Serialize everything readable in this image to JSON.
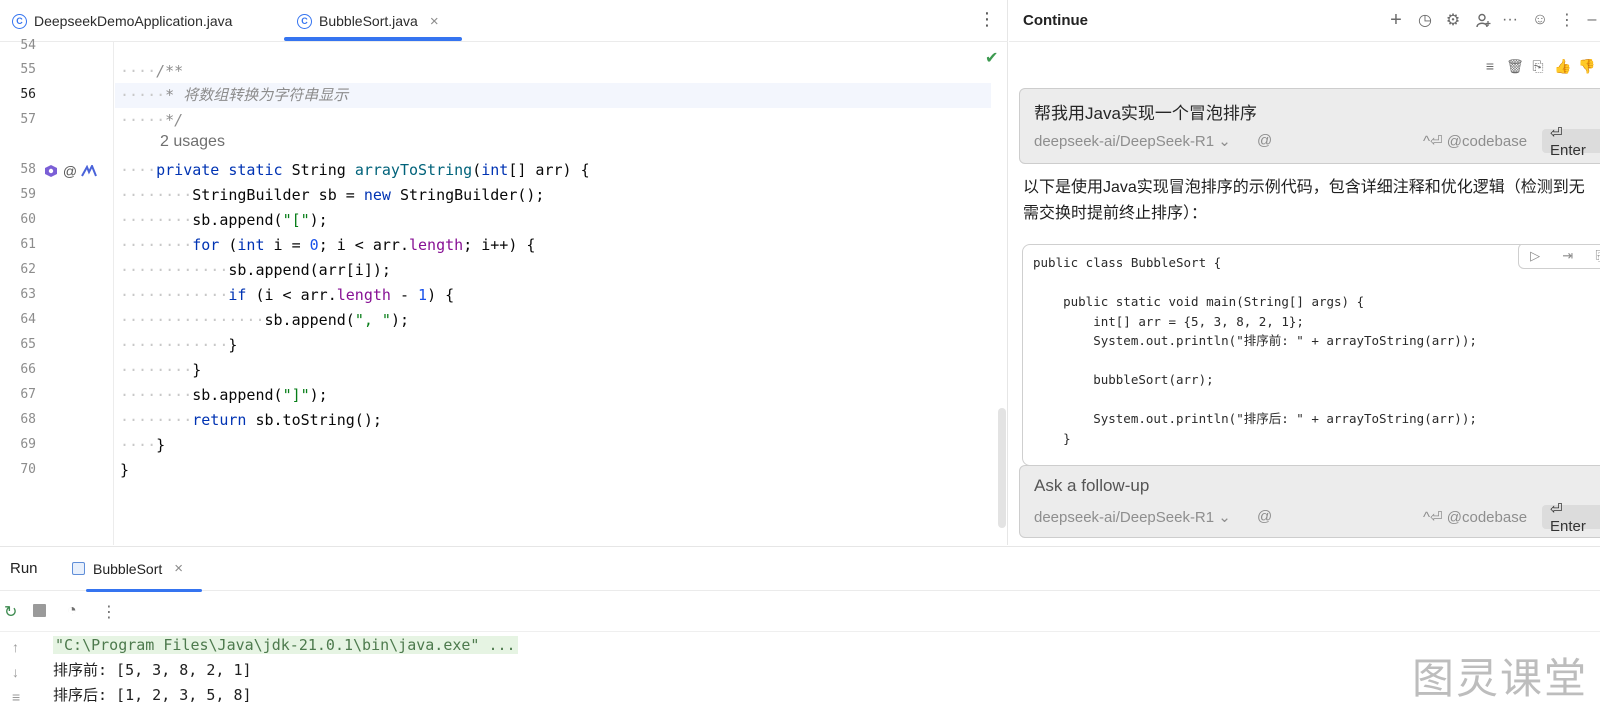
{
  "editor": {
    "tabs": [
      {
        "label": "DeepseekDemoApplication.java",
        "active": false
      },
      {
        "label": "BubbleSort.java",
        "active": true
      }
    ],
    "close_glyph": "×",
    "more_glyph": "⋮",
    "usages_hint": "2 usages",
    "line_numbers": [
      "54",
      "55",
      "56",
      "57",
      "58",
      "59",
      "60",
      "61",
      "62",
      "63",
      "64",
      "65",
      "66",
      "67",
      "68",
      "69",
      "70"
    ],
    "current_line": "56",
    "accent_color": "#3574f0"
  },
  "continue_panel": {
    "title": "Continue",
    "user_message": "帮我用Java实现一个冒泡排序",
    "model": "deepseek-ai/DeepSeek-R1",
    "at_symbol": "@",
    "codebase_hint": "^⏎ @codebase",
    "enter_label": "⏎ Enter",
    "reply_text": "以下是使用Java实现冒泡排序的示例代码，包含详细注释和优化逻辑（检测到无需交换时提前终止排序）：",
    "code_lines": [
      "public class BubbleSort {",
      "",
      "    public static void main(String[] args) {",
      "        int[] arr = {5, 3, 8, 2, 1};",
      "        System.out.println(\"排序前: \" + arrayToString(arr));",
      "",
      "        bubbleSort(arr);",
      "",
      "        System.out.println(\"排序后: \" + arrayToString(arr));",
      "    }"
    ],
    "followup_placeholder": "Ask a follow-up"
  },
  "run_panel": {
    "label": "Run",
    "tab_label": "BubbleSort",
    "console_lines": [
      "\"C:\\Program Files\\Java\\jdk-21.0.1\\bin\\java.exe\" ...",
      "排序前: [5, 3, 8, 2, 1]",
      "排序后: [1, 2, 3, 5, 8]"
    ]
  },
  "watermark": "图灵课堂"
}
